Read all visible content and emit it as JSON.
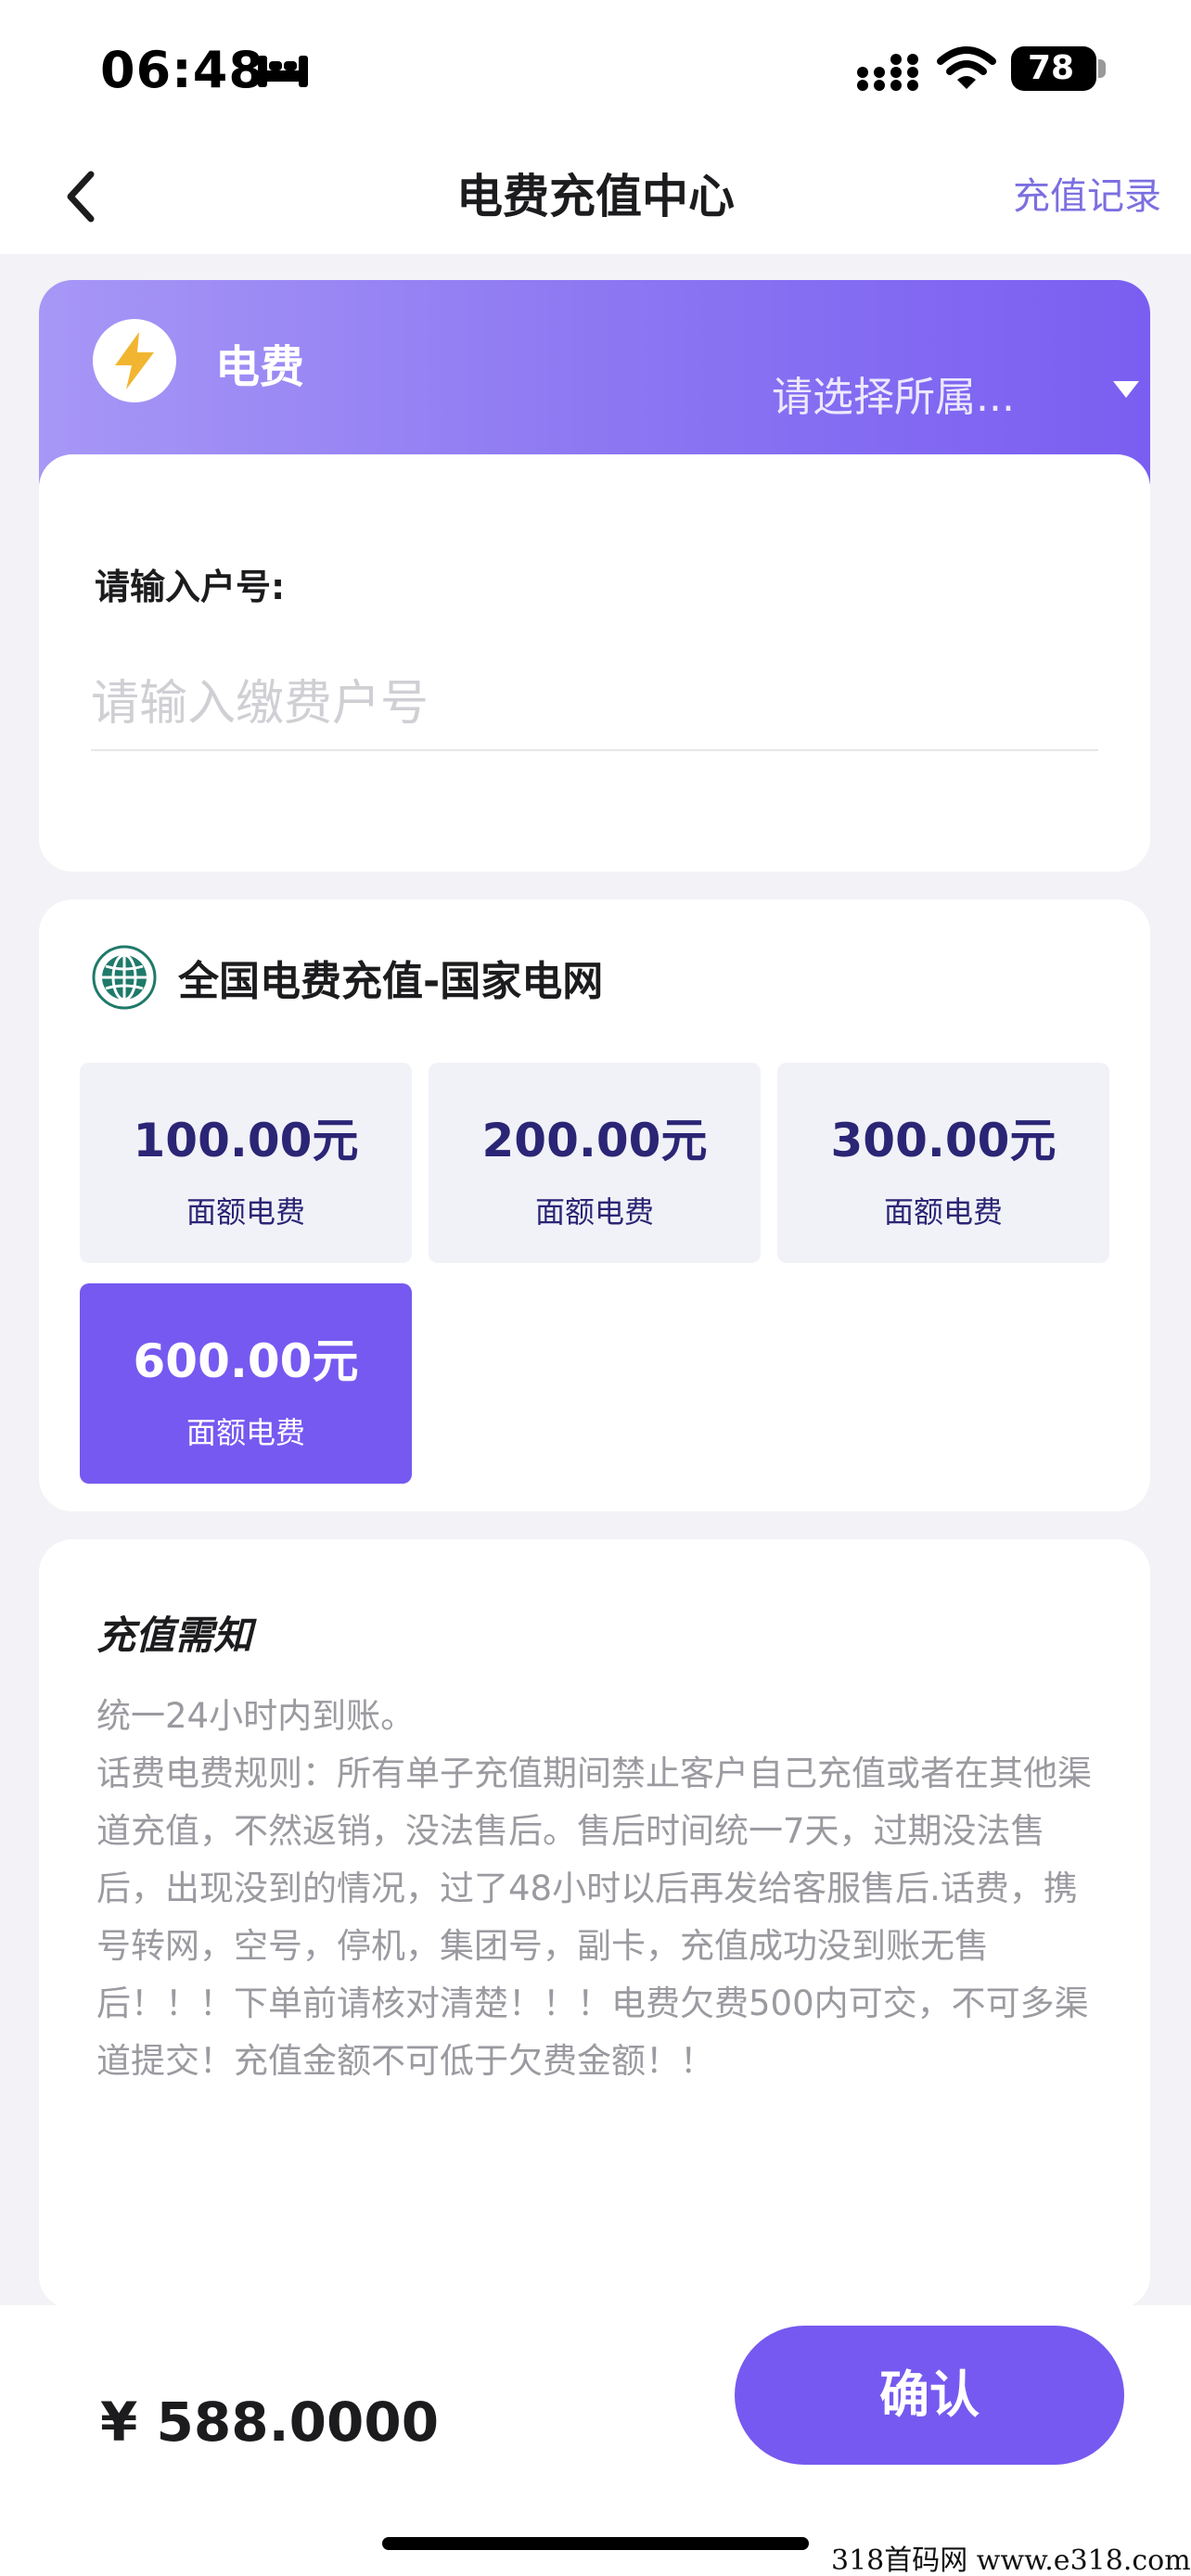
{
  "status_bar": {
    "time": "06:48",
    "battery": "78",
    "icons": [
      "bed-icon",
      "signal-icon",
      "wifi-icon",
      "battery-icon"
    ]
  },
  "nav": {
    "title": "电费充值中心",
    "record_link": "充值记录",
    "back_icon": "chevron-left-icon"
  },
  "electricity": {
    "label": "电费",
    "icon": "lightning-bolt-icon",
    "region_placeholder": "请选择所属...",
    "input_label": "请输入户号:",
    "input_placeholder": "请输入缴费户号",
    "input_value": ""
  },
  "denominations": {
    "title": "全国电费充值-国家电网",
    "logo": "state-grid-logo",
    "items": [
      {
        "amount": "100.00元",
        "sub": "面额电费",
        "selected": false
      },
      {
        "amount": "200.00元",
        "sub": "面额电费",
        "selected": false
      },
      {
        "amount": "300.00元",
        "sub": "面额电费",
        "selected": false
      },
      {
        "amount": "600.00元",
        "sub": "面额电费",
        "selected": true
      }
    ]
  },
  "notice": {
    "title": "充值需知",
    "lines": [
      "统一24小时内到账。",
      "话费电费规则：所有单子充值期间禁止客户自己充值或者在其他渠道充值，不然返销，没法售后。售后时间统一7天，过期没法售后，出现没到的情况，过了48小时以后再发给客服售后.话费，携号转网，空号，停机，集团号，副卡，充值成功没到账无售后！！！下单前请核对清楚！！！电费欠费500内可交，不可多渠道提交！充值金额不可低于欠费金额！！"
    ]
  },
  "footer": {
    "total": "¥ 588.0000",
    "confirm_label": "确认"
  },
  "watermark": "318首码网  www.e318.com",
  "colors": {
    "accent": "#7659f0",
    "header_gradient_start": "#a797f6",
    "header_gradient_end": "#7a5ef1",
    "amount_text": "#2b2575",
    "bolt": "#f2b531"
  }
}
